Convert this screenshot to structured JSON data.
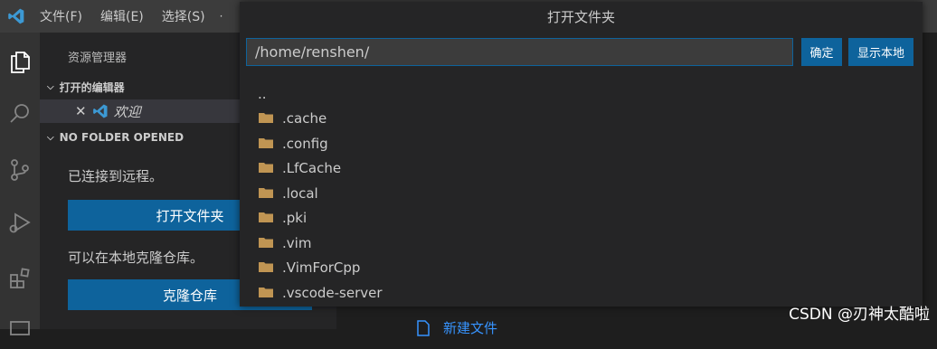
{
  "menubar": {
    "file": "文件(F)",
    "edit": "编辑(E)",
    "selection": "选择(S)",
    "more": "·"
  },
  "sidebar": {
    "title": "资源管理器",
    "open_editors_header": "打开的编辑器",
    "open_editor_item": "欢迎",
    "no_folder_header": "NO FOLDER OPENED",
    "connected_text": "已连接到远程。",
    "open_folder_button": "打开文件夹",
    "clone_text": "可以在本地克隆仓库。",
    "clone_button": "克隆仓库"
  },
  "editor": {
    "new_file_link": "新建文件"
  },
  "dialog": {
    "title": "打开文件夹",
    "path_value": "/home/renshen/",
    "ok_button": "确定",
    "show_local_button": "显示本地",
    "parent_entry": "..",
    "items": [
      ".cache",
      ".config",
      ".LfCache",
      ".local",
      ".pki",
      ".vim",
      ".VimForCpp",
      ".vscode-server"
    ]
  },
  "watermark": "CSDN @刃神太酷啦",
  "colors": {
    "accent": "#0e639c",
    "folder": "#c09553",
    "logo": "#3c99d4"
  }
}
